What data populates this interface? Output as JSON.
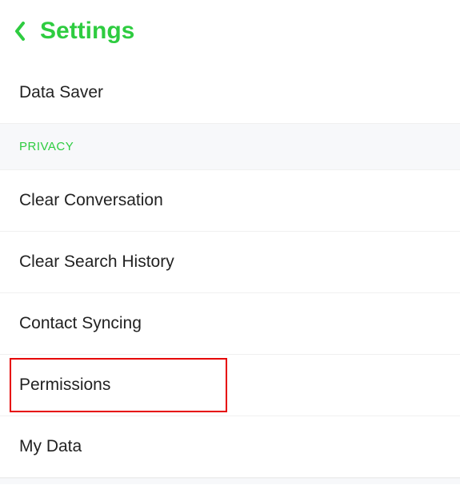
{
  "header": {
    "title": "Settings"
  },
  "rows": {
    "data_saver": "Data Saver",
    "privacy_section": "PRIVACY",
    "clear_conversation": "Clear Conversation",
    "clear_search_history": "Clear Search History",
    "contact_syncing": "Contact Syncing",
    "permissions": "Permissions",
    "my_data": "My Data"
  }
}
